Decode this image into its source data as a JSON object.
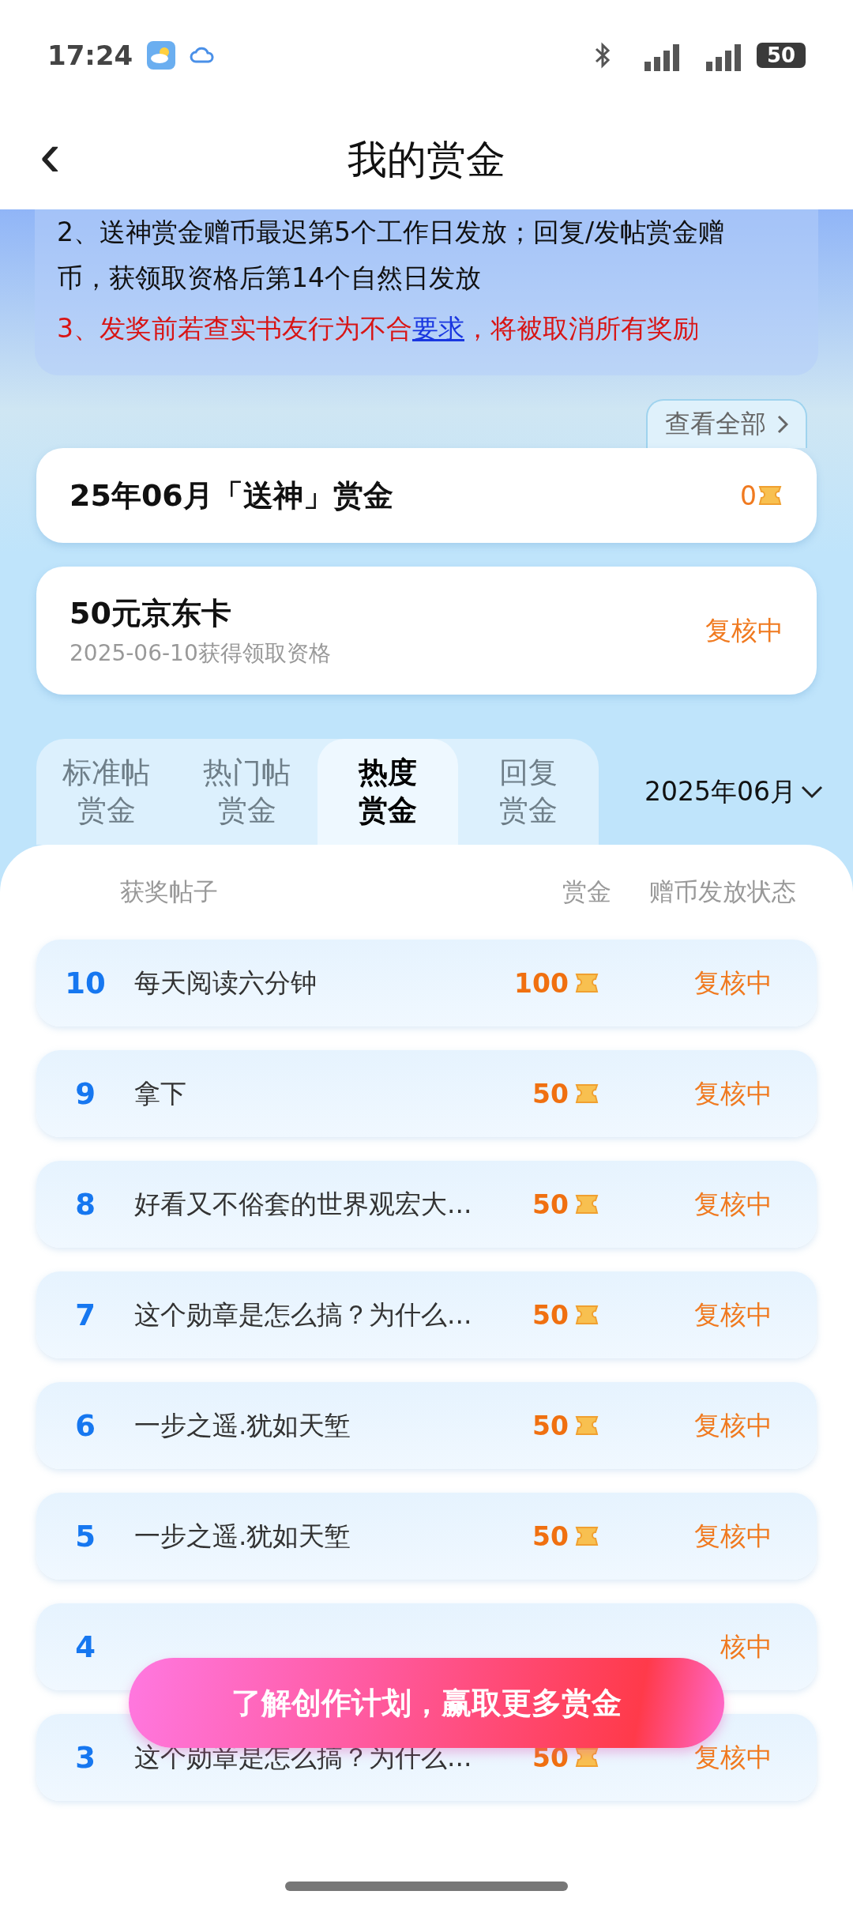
{
  "status_bar": {
    "time": "17:24",
    "battery": "50"
  },
  "header": {
    "back": "‹",
    "title": "我的赏金"
  },
  "rules": [
    {
      "kind": "plain",
      "text": "2、送神赏金赠币最迟第5个工作日发放；回复/发帖赏金赠币，获领取资格后第14个自然日发放"
    },
    {
      "kind": "warning",
      "text": "3、发奖前若查实书友行为不合",
      "link": "要求",
      "after": "，将被取消所有奖励"
    }
  ],
  "view_all": {
    "label": "查看全部"
  },
  "monthly_card": {
    "title": "25年06月「送神」赏金",
    "amount": "0"
  },
  "prize_card": {
    "title": "50元京东卡",
    "date": "2025-06-10获得领取资格",
    "status": "复核中"
  },
  "tabs": [
    {
      "label": "标准帖赏金",
      "selected": false
    },
    {
      "label": "热门帖赏金",
      "selected": false
    },
    {
      "label": "热度赏金",
      "selected": true
    },
    {
      "label": "回复赏金",
      "selected": false
    }
  ],
  "month_picker": {
    "label": "2025年06月"
  },
  "table": {
    "columns": [
      "获奖帖子",
      "赏金",
      "赠币发放状态"
    ],
    "rows": [
      {
        "rank": "10",
        "title": "每天阅读六分钟",
        "reward": "100",
        "status": "复核中"
      },
      {
        "rank": "9",
        "title": "拿下",
        "reward": "50",
        "status": "复核中"
      },
      {
        "rank": "8",
        "title": "好看又不俗套的世界观宏大...",
        "reward": "50",
        "status": "复核中"
      },
      {
        "rank": "7",
        "title": "这个勋章是怎么搞？为什么...",
        "reward": "50",
        "status": "复核中"
      },
      {
        "rank": "6",
        "title": "一步之遥.犹如天堑",
        "reward": "50",
        "status": "复核中"
      },
      {
        "rank": "5",
        "title": "一步之遥.犹如天堑",
        "reward": "50",
        "status": "复核中"
      },
      {
        "rank": "4",
        "status": "核中"
      },
      {
        "rank": "3",
        "title": "这个勋章是怎么搞？为什么...",
        "reward": "50",
        "status": "复核中"
      }
    ]
  },
  "cta": {
    "label": "了解创作计划，赢取更多赏金"
  }
}
